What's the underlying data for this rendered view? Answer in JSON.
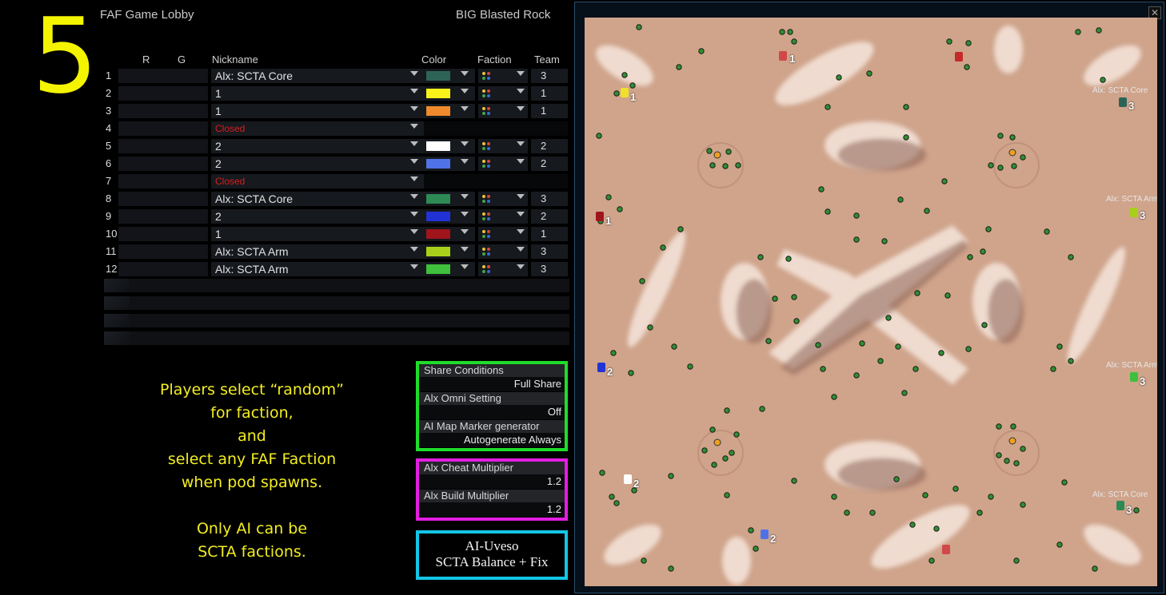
{
  "step_number": "5",
  "lobby_title": "FAF Game Lobby",
  "map_name": "BIG Blasted Rock",
  "columns": {
    "r": "R",
    "g": "G",
    "nickname": "Nickname",
    "color": "Color",
    "faction": "Faction",
    "team": "Team"
  },
  "slots": [
    {
      "num": "1",
      "nick": "Alx: SCTA Core",
      "closed": false,
      "color": "#2d6357",
      "team": "3"
    },
    {
      "num": "2",
      "nick": "1",
      "closed": false,
      "color": "#f7f21a",
      "team": "1"
    },
    {
      "num": "3",
      "nick": "1",
      "closed": false,
      "color": "#f08a2c",
      "team": "1"
    },
    {
      "num": "4",
      "nick": "Closed",
      "closed": true
    },
    {
      "num": "5",
      "nick": "2",
      "closed": false,
      "color": "#ffffff",
      "team": "2"
    },
    {
      "num": "6",
      "nick": "2",
      "closed": false,
      "color": "#4f73e6",
      "team": "2"
    },
    {
      "num": "7",
      "nick": "Closed",
      "closed": true
    },
    {
      "num": "8",
      "nick": "Alx: SCTA Core",
      "closed": false,
      "color": "#2e8a55",
      "team": "3"
    },
    {
      "num": "9",
      "nick": "2",
      "closed": false,
      "color": "#2233d6",
      "team": "2"
    },
    {
      "num": "10",
      "nick": "1",
      "closed": false,
      "color": "#a0141c",
      "team": "1"
    },
    {
      "num": "11",
      "nick": "Alx: SCTA Arm",
      "closed": false,
      "color": "#a8d01a",
      "team": "3"
    },
    {
      "num": "12",
      "nick": "Alx: SCTA Arm",
      "closed": false,
      "color": "#3fbf3c",
      "team": "3"
    }
  ],
  "note_lines": [
    "Players select “random”",
    "for faction,",
    "and",
    "select any FAF Faction",
    "when pod spawns.",
    "",
    "Only AI can be",
    "SCTA factions."
  ],
  "options_green": [
    {
      "label": "Share Conditions",
      "value": "Full Share"
    },
    {
      "label": "Alx Omni Setting",
      "value": "Off"
    },
    {
      "label": "AI Map Marker generator",
      "value": "Autogenerate Always"
    }
  ],
  "options_magenta": [
    {
      "label": "Alx Cheat Multiplier",
      "value": "1.2"
    },
    {
      "label": "Alx Build Multiplier",
      "value": "1.2"
    }
  ],
  "credit_lines": [
    "AI-Uveso",
    "SCTA Balance + Fix"
  ],
  "map_labels": [
    "Alx: SCTA Core",
    "Alx: SCTA Arm",
    "Alx: SCTA Arm",
    "Alx: SCTA Core"
  ],
  "spawn_numbers": [
    "1",
    "1",
    "3",
    "1",
    "3",
    "2",
    "3",
    "2",
    "2",
    "3"
  ],
  "colors": {
    "highlight_yellow": "#f4f400",
    "green_frame": "#1fdc2a",
    "magenta_frame": "#e21ee0",
    "cyan_frame": "#14c6e6",
    "closed_red": "#d61f1f"
  }
}
